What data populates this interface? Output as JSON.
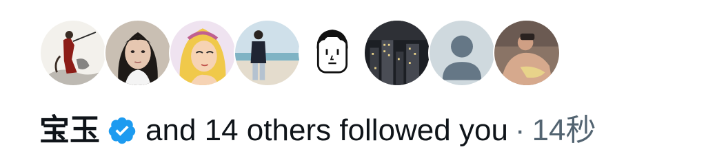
{
  "avatars": [
    {
      "name": "follower-avatar-1",
      "icon": "painting-figure"
    },
    {
      "name": "follower-avatar-2",
      "icon": "woman-portrait"
    },
    {
      "name": "follower-avatar-3",
      "icon": "cartoon-girl"
    },
    {
      "name": "follower-avatar-4",
      "icon": "beach-person"
    },
    {
      "name": "follower-avatar-5",
      "icon": "line-face"
    },
    {
      "name": "follower-avatar-6",
      "icon": "city-night"
    },
    {
      "name": "follower-avatar-7",
      "icon": "default-avatar"
    },
    {
      "name": "follower-avatar-8",
      "icon": "person-photo"
    }
  ],
  "notification": {
    "user_name": "宝玉",
    "verified_icon": "verified-badge-icon",
    "action_text": "and 14 others followed you",
    "separator": "·",
    "time": "14秒"
  },
  "colors": {
    "verified": "#1d9bf0",
    "primary_text": "#0f1419",
    "secondary_text": "#536471"
  }
}
